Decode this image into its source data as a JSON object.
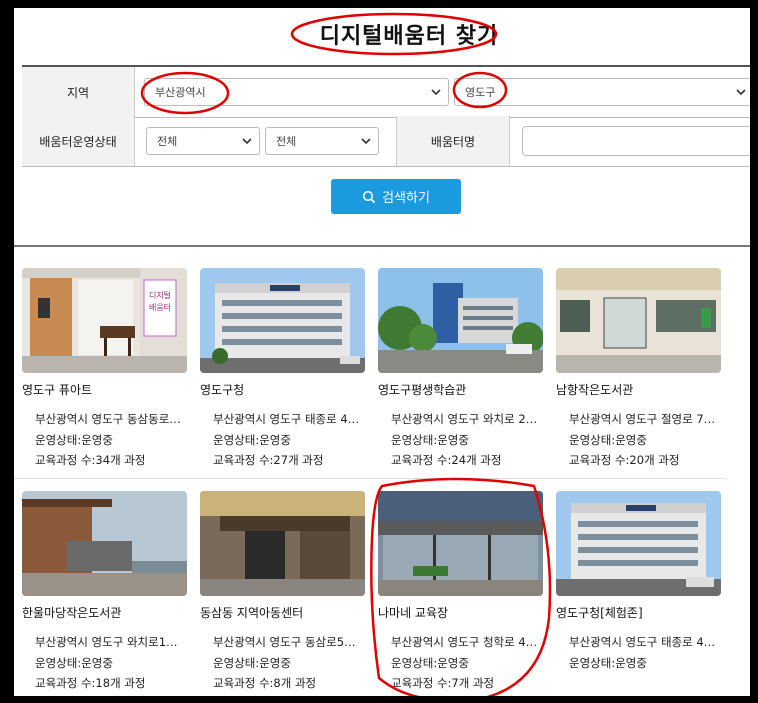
{
  "page": {
    "title": "디지털배움터 찾기"
  },
  "form": {
    "region_label": "지역",
    "city_value": "부산광역시",
    "district_value": "영도구",
    "status_label": "배움터운영상태",
    "status1_value": "전체",
    "status2_value": "전체",
    "name_label": "배움터명",
    "name_value": "",
    "search_button": "검색하기"
  },
  "cards": [
    {
      "name": "영도구 퓨아트",
      "address": "부산광역시 영도구 동삼동로…",
      "status": "운영상태:운영중",
      "courses": "교육과정 수:34개 과정"
    },
    {
      "name": "영도구청",
      "address": "부산광역시 영도구 태종로 4…",
      "status": "운영상태:운영중",
      "courses": "교육과정 수:27개 과정"
    },
    {
      "name": "영도구평생학습관",
      "address": "부산광역시 영도구 와치로 2…",
      "status": "운영상태:운영중",
      "courses": "교육과정 수:24개 과정"
    },
    {
      "name": "남항작은도서관",
      "address": "부산광역시 영도구 절영로 7…",
      "status": "운영상태:운영중",
      "courses": "교육과정 수:20개 과정"
    },
    {
      "name": "한울마당작은도서관",
      "address": "부산광역시 영도구 와치로1…",
      "status": "운영상태:운영중",
      "courses": "교육과정 수:18개 과정"
    },
    {
      "name": "동삼동 지역아동센터",
      "address": "부산광역시 영도구 동삼로5…",
      "status": "운영상태:운영중",
      "courses": "교육과정 수:8개 과정"
    },
    {
      "name": "나마네 교육장",
      "address": "부산광역시 영도구 청학로 4…",
      "status": "운영상태:운영중",
      "courses": "교육과정 수:7개 과정"
    },
    {
      "name": "영도구청[체험존]",
      "address": "부산광역시 영도구 태종로 4…",
      "status": "운영상태:운영중",
      "courses": ""
    }
  ],
  "thumb_signs": {
    "card0": "디지털\n배움터"
  },
  "colors": {
    "accent": "#1a9be0",
    "annotation": "#e00000"
  }
}
